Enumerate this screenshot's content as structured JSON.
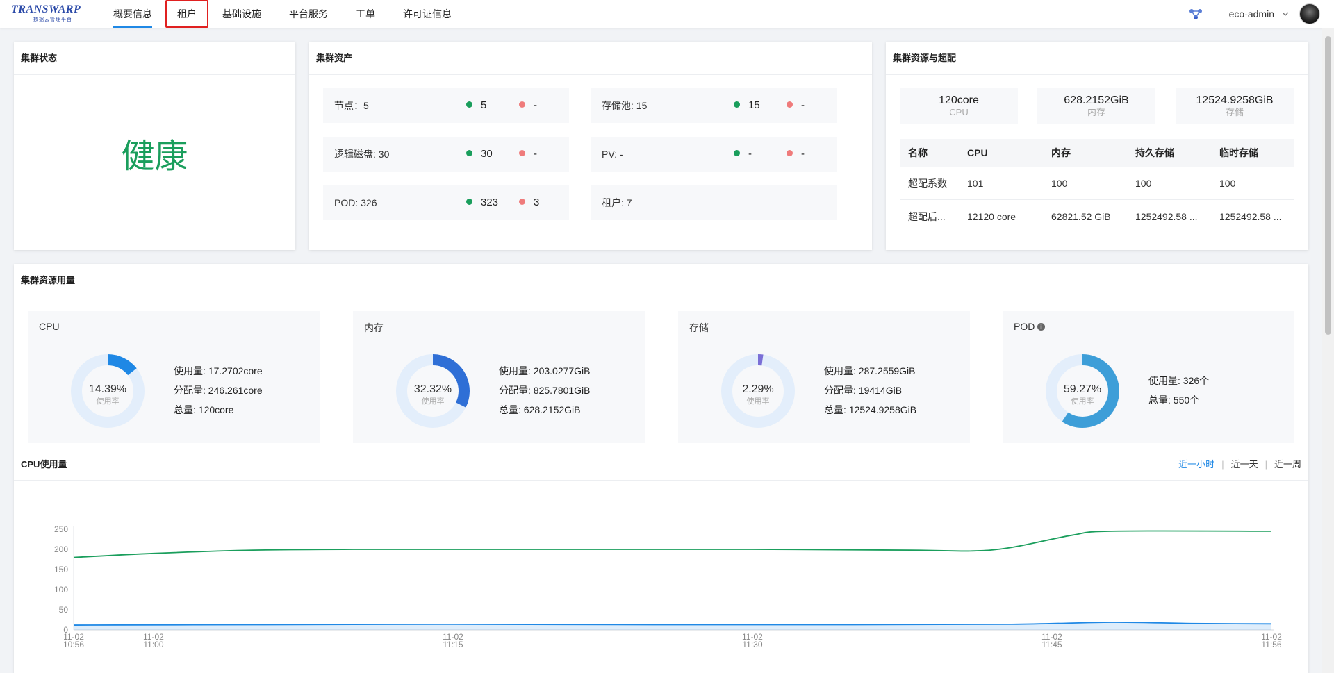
{
  "logo": {
    "main": "TRANSWARP",
    "sub": "数据云管理平台"
  },
  "nav": [
    {
      "label": "概要信息",
      "active": true
    },
    {
      "label": "租户"
    },
    {
      "label": "基础设施"
    },
    {
      "label": "平台服务"
    },
    {
      "label": "工单"
    },
    {
      "label": "许可证信息"
    }
  ],
  "user": {
    "name": "eco-admin"
  },
  "status_card": {
    "title": "集群状态",
    "value": "健康"
  },
  "asset_card": {
    "title": "集群资产",
    "items": [
      {
        "label": "节点：5",
        "ok": "5",
        "bad": "-"
      },
      {
        "label": "存储池: 15",
        "ok": "15",
        "bad": "-"
      },
      {
        "label": "逻辑磁盘: 30",
        "ok": "30",
        "bad": "-"
      },
      {
        "label": "PV: -",
        "ok": "-",
        "bad": "-"
      },
      {
        "label": "POD: 326",
        "ok": "323",
        "bad": "3"
      },
      {
        "label": "租户: 7"
      }
    ]
  },
  "overcommit_card": {
    "title": "集群资源与超配",
    "summary": [
      {
        "value": "120core",
        "label": "CPU"
      },
      {
        "value": "628.2152GiB",
        "label": "内存"
      },
      {
        "value": "12524.9258GiB",
        "label": "存储"
      }
    ],
    "columns": [
      "名称",
      "CPU",
      "内存",
      "持久存储",
      "临时存储"
    ],
    "rows": [
      [
        "超配系数",
        "101",
        "100",
        "100",
        "100"
      ],
      [
        "超配后...",
        "12120 core",
        "62821.52 GiB",
        "1252492.58 ...",
        "1252492.58 ..."
      ]
    ]
  },
  "usage_card": {
    "title": "集群资源用量",
    "resources": [
      {
        "name": "CPU",
        "percent": 14.39,
        "percent_text": "14.39%",
        "rate_label": "使用率",
        "color": "#1f88e5",
        "info": [
          "使用量: 17.2702core",
          "分配量: 246.261core",
          "总量: 120core"
        ]
      },
      {
        "name": "内存",
        "percent": 32.32,
        "percent_text": "32.32%",
        "rate_label": "使用率",
        "color": "#2f6fd6",
        "info": [
          "使用量: 203.0277GiB",
          "分配量: 825.7801GiB",
          "总量: 628.2152GiB"
        ]
      },
      {
        "name": "存储",
        "percent": 2.29,
        "percent_text": "2.29%",
        "rate_label": "使用率",
        "color": "#7b6fd6",
        "info": [
          "使用量: 287.2559GiB",
          "分配量: 19414GiB",
          "总量: 12524.9258GiB"
        ]
      },
      {
        "name": "POD",
        "percent": 59.27,
        "percent_text": "59.27%",
        "rate_label": "使用率",
        "color": "#3d9ed8",
        "info": [
          "使用量: 326个",
          "总量: 550个"
        ]
      }
    ],
    "cpu_section": {
      "title": "CPU使用量",
      "tabs": [
        {
          "label": "近一小时",
          "active": true
        },
        {
          "label": "近一天"
        },
        {
          "label": "近一周"
        }
      ]
    }
  },
  "chart_data": {
    "type": "line",
    "ylim": [
      0,
      250
    ],
    "y_ticks": [
      0,
      50,
      100,
      150,
      200,
      250
    ],
    "xlim": [
      "11-02 10:56",
      "11-02 11:56"
    ],
    "x_ticks": [
      {
        "label": [
          "11-02",
          "10:56"
        ]
      },
      {
        "label": [
          "11-02",
          "11:00"
        ]
      },
      {
        "label": [
          "11-02",
          "11:15"
        ]
      },
      {
        "label": [
          "11-02",
          "11:30"
        ]
      },
      {
        "label": [
          "11-02",
          "11:45"
        ]
      },
      {
        "label": [
          "11-02",
          "11:56"
        ]
      }
    ],
    "series": [
      {
        "color": "#1a9e5c",
        "area": false,
        "points": [
          [
            "10:56",
            180
          ],
          [
            "11:00",
            190
          ],
          [
            "11:05",
            198
          ],
          [
            "11:10",
            200
          ],
          [
            "11:20",
            200
          ],
          [
            "11:30",
            200
          ],
          [
            "11:38",
            198
          ],
          [
            "11:41",
            196
          ],
          [
            "11:43",
            205
          ],
          [
            "11:46",
            235
          ],
          [
            "11:48",
            245
          ],
          [
            "11:56",
            245
          ]
        ]
      },
      {
        "color": "#1f88e5",
        "area": true,
        "points": [
          [
            "10:56",
            12
          ],
          [
            "11:05",
            13
          ],
          [
            "11:15",
            14
          ],
          [
            "11:25",
            13
          ],
          [
            "11:35",
            13
          ],
          [
            "11:43",
            14
          ],
          [
            "11:48",
            19
          ],
          [
            "11:52",
            16
          ],
          [
            "11:56",
            15
          ]
        ]
      }
    ]
  }
}
